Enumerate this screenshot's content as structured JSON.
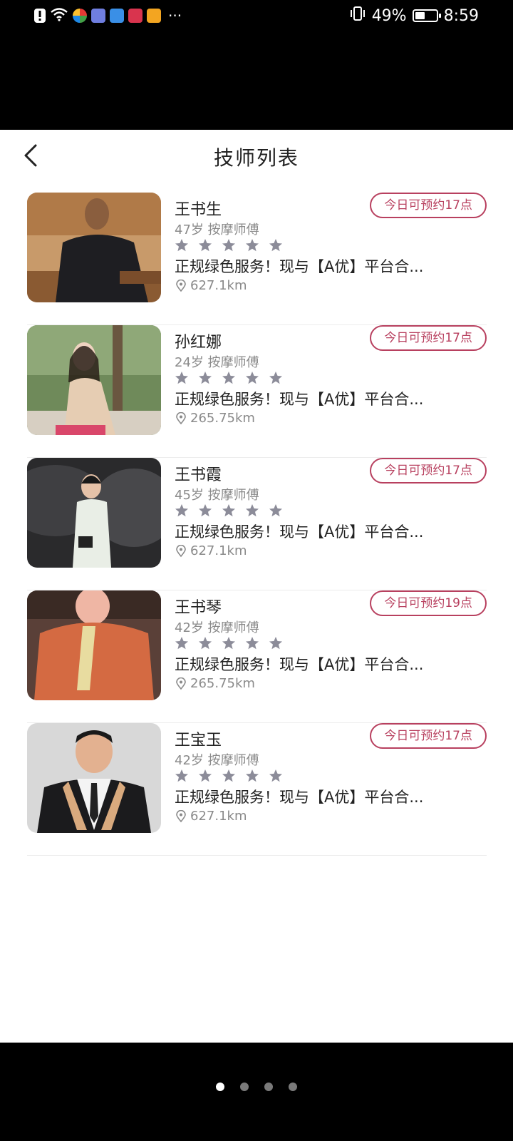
{
  "status_bar": {
    "battery": "49%",
    "battery_level": 0.49,
    "time": "8:59",
    "more": "···",
    "icons": [
      "alert-icon",
      "wifi-icon",
      "app-icon-multicolor",
      "music-app-icon",
      "browser-app-icon",
      "book-app-icon",
      "pay-app-icon",
      "vibrate-icon",
      "battery-icon"
    ]
  },
  "header": {
    "title": "技师列表",
    "back_icon": "chevron-left-icon"
  },
  "technicians": [
    {
      "name": "王书生",
      "meta": "47岁 按摩师傅",
      "rating": 5,
      "desc": "正规绿色服务！现与【A优】平台合...",
      "distance": "627.1km",
      "badge": "今日可预约17点"
    },
    {
      "name": "孙红娜",
      "meta": "24岁 按摩师傅",
      "rating": 5,
      "desc": "正规绿色服务！现与【A优】平台合...",
      "distance": "265.75km",
      "badge": "今日可预约17点"
    },
    {
      "name": "王书霞",
      "meta": "45岁 按摩师傅",
      "rating": 5,
      "desc": "正规绿色服务！现与【A优】平台合...",
      "distance": "627.1km",
      "badge": "今日可预约17点"
    },
    {
      "name": "王书琴",
      "meta": "42岁 按摩师傅",
      "rating": 5,
      "desc": "正规绿色服务！现与【A优】平台合...",
      "distance": "265.75km",
      "badge": "今日可预约19点"
    },
    {
      "name": "王宝玉",
      "meta": "42岁 按摩师傅",
      "rating": 5,
      "desc": "正规绿色服务！现与【A优】平台合...",
      "distance": "627.1km",
      "badge": "今日可预约17点"
    }
  ],
  "page_indicator": {
    "count": 4,
    "active": 0
  },
  "colors": {
    "accent": "#b8405f",
    "star": "#8c8c99",
    "muted_text": "#8a8a8a"
  }
}
